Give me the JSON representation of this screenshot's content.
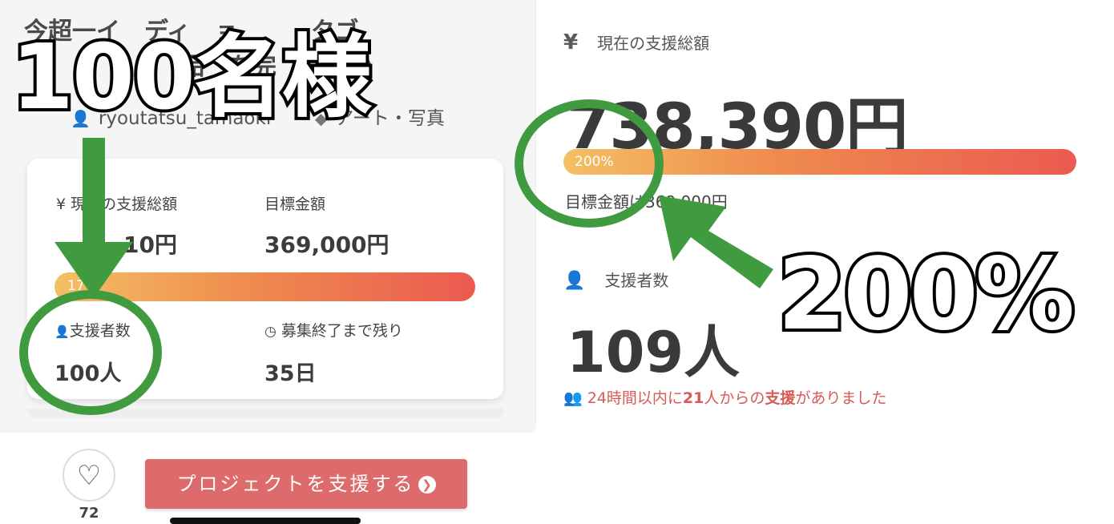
{
  "left": {
    "title_line1": "今超一イ　ディ　ョ　　　タゴ",
    "title_line2": "品　を完　　　か",
    "creator": "ryoutatsu_tamaoki",
    "category": "アート・写真",
    "stats": {
      "current_label": "現在の支援総額",
      "current_value": "　　　10円",
      "goal_label": "目標金額",
      "goal_value": "369,000円",
      "progress_label": "17%",
      "progress_fraction": 0.17,
      "supporters_label": "支援者数",
      "supporters_value": "100人",
      "remaining_label": "募集終了まで残り",
      "remaining_value": "35日"
    },
    "like_count": "72",
    "support_button_label": "プロジェクトを支援する"
  },
  "right": {
    "current_label": "現在の支援総額",
    "current_value": "738,390円",
    "progress_label": "200%",
    "progress_fraction": 2.0,
    "goal_text": "目標金額は369,000円",
    "supporters_label": "支援者数",
    "supporters_value": "109人",
    "recent_prefix": "24時間以内に",
    "recent_count": "21",
    "recent_mid": "人からの",
    "recent_emph": "支援",
    "recent_suffix": "がありました"
  },
  "annotations": {
    "left_caption": "100名様",
    "right_caption": "200%",
    "color": "#3f9a40"
  },
  "icons": {
    "yen": "¥",
    "user": "user-icon",
    "tag": "tag-icon",
    "clock": "clock-icon",
    "heart": "heart-icon"
  },
  "colors": {
    "accent_red": "#de6b6b",
    "progress_start": "#f3c064",
    "progress_end": "#eb5a50"
  }
}
